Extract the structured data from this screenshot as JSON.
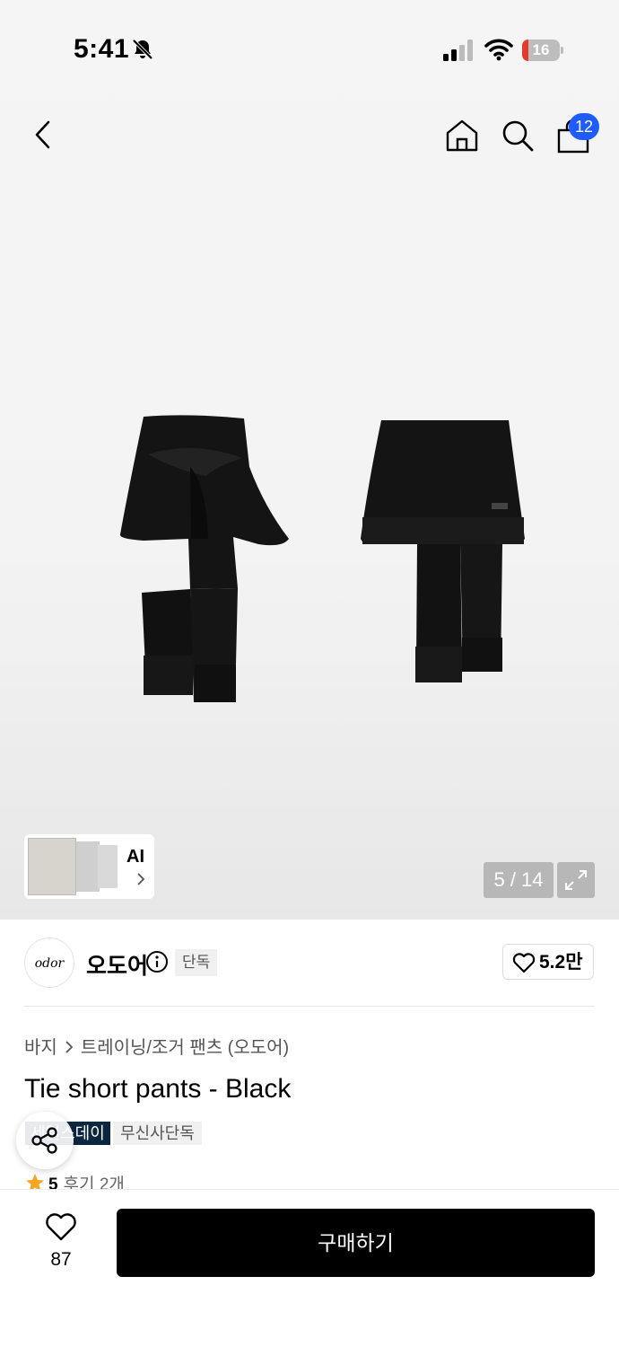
{
  "status_bar": {
    "time": "5:41",
    "battery_level": "16",
    "battery_fraction": 0.16,
    "icons": [
      "bell-slash-icon",
      "signal-icon",
      "wifi-icon",
      "battery-icon"
    ]
  },
  "nav": {
    "icons": [
      "chevron-left-icon",
      "home-icon",
      "search-icon",
      "shopping-bag-icon"
    ],
    "cart_count": "12"
  },
  "gallery": {
    "ai_label": "AI",
    "counter": "5 / 14",
    "expand_icon": "expand-icon"
  },
  "brand": {
    "logo_text": "odor",
    "name": "오도어",
    "exclusive_tag": "단독",
    "likes": "5.2만"
  },
  "product": {
    "breadcrumb": [
      "바지",
      "트레이닝/조거 팬츠 (오도어)"
    ],
    "title": "Tie short pants - Black",
    "tags": [
      "세일스데이",
      "무신사단독"
    ],
    "rating": "5",
    "reviews": "후기 2개"
  },
  "bottom_bar": {
    "wish_count": "87",
    "buy_label": "구매하기"
  },
  "colors": {
    "accent_badge": "#1f5cff",
    "battery_low": "#e5392e",
    "tag_dark": "#0b2740",
    "star": "#f5a623"
  }
}
